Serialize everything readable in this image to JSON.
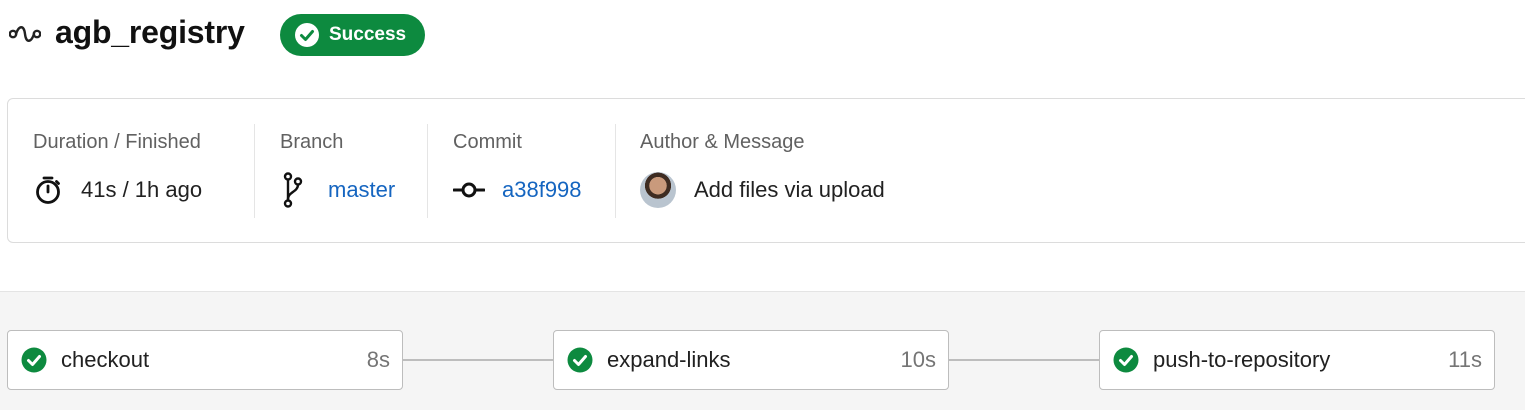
{
  "header": {
    "title": "agb_registry",
    "status": "Success",
    "status_color": "#0d8a3f"
  },
  "info": {
    "duration": {
      "label": "Duration / Finished",
      "value": "41s / 1h ago"
    },
    "branch": {
      "label": "Branch",
      "value": "master"
    },
    "commit": {
      "label": "Commit",
      "value": "a38f998"
    },
    "author": {
      "label": "Author & Message",
      "message": "Add files via upload"
    }
  },
  "stages": [
    {
      "name": "checkout",
      "duration": "8s",
      "status": "success"
    },
    {
      "name": "expand-links",
      "duration": "10s",
      "status": "success"
    },
    {
      "name": "push-to-repository",
      "duration": "11s",
      "status": "success"
    }
  ],
  "colors": {
    "success": "#0d8a3f",
    "link": "#1565c0"
  },
  "icons": [
    "repo-icon",
    "check-circle-icon",
    "stopwatch-icon",
    "branch-icon",
    "commit-icon",
    "avatar"
  ]
}
